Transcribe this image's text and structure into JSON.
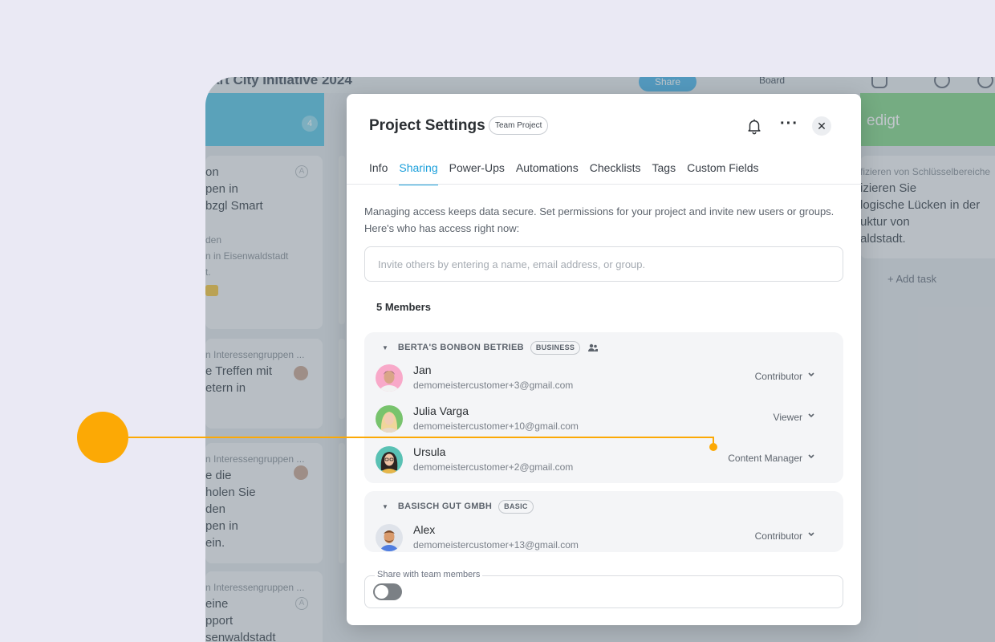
{
  "background_app": {
    "title": "art City Initiative 2024",
    "share_label": "Share",
    "view_label": "Board",
    "column_count": "4",
    "done_column_label": "edigt",
    "add_task_label": "+ Add task",
    "cards": [
      {
        "lines": [
          "on",
          "pen in",
          "bzgl Smart"
        ],
        "sub": [
          "den",
          "n in Eisenwaldstadt",
          "t."
        ]
      },
      {
        "header": "n Interessengruppen ...",
        "lines": [
          "e Treffen mit",
          "etern in"
        ]
      },
      {
        "header": "n Interessengruppen ...",
        "lines": [
          "e die",
          " holen Sie",
          "den",
          "pen in",
          "ein."
        ]
      },
      {
        "header": "n Interessengruppen ...",
        "lines": [
          "eine",
          "pport",
          "senwaldstadt"
        ]
      }
    ],
    "done_card": {
      "header": "fizieren von Schlüsselbereiche",
      "lines": [
        "izieren Sie",
        "logische Lücken in der",
        "uktur von",
        "aldstadt."
      ]
    }
  },
  "modal": {
    "title": "Project Settings",
    "badge": "Team Project",
    "tabs": [
      "Info",
      "Sharing",
      "Power-Ups",
      "Automations",
      "Checklists",
      "Tags",
      "Custom Fields"
    ],
    "active_tab": "Sharing",
    "description": "Managing access keeps data secure. Set permissions for your project and invite new users or groups. Here's who has access right now:",
    "invite_placeholder": "Invite others by entering a name, email address, or group.",
    "members_count_label": "5 Members",
    "groups": [
      {
        "name": "BERTA'S BONBON BETRIEB",
        "plan": "BUSINESS",
        "members": [
          {
            "name": "Jan",
            "email": "demomeistercustomer+3@gmail.com",
            "role": "Contributor"
          },
          {
            "name": "Julia Varga",
            "email": "demomeistercustomer+10@gmail.com",
            "role": "Viewer"
          },
          {
            "name": "Ursula",
            "email": "demomeistercustomer+2@gmail.com",
            "role": "Content Manager"
          }
        ]
      },
      {
        "name": "BASISCH GUT GMBH",
        "plan": "BASIC",
        "members": [
          {
            "name": "Alex",
            "email": "demomeistercustomer+13@gmail.com",
            "role": "Contributor"
          }
        ]
      }
    ],
    "share_team_label": "Share with team members",
    "share_team_enabled": false
  },
  "colors": {
    "accent": "#1a9fdb",
    "callout": "#fca905",
    "toggle_off": "#7b8085"
  },
  "icons": [
    "bell-icon",
    "more-icon",
    "close-icon",
    "caret-down-icon",
    "people-icon",
    "chevron-down-icon"
  ]
}
